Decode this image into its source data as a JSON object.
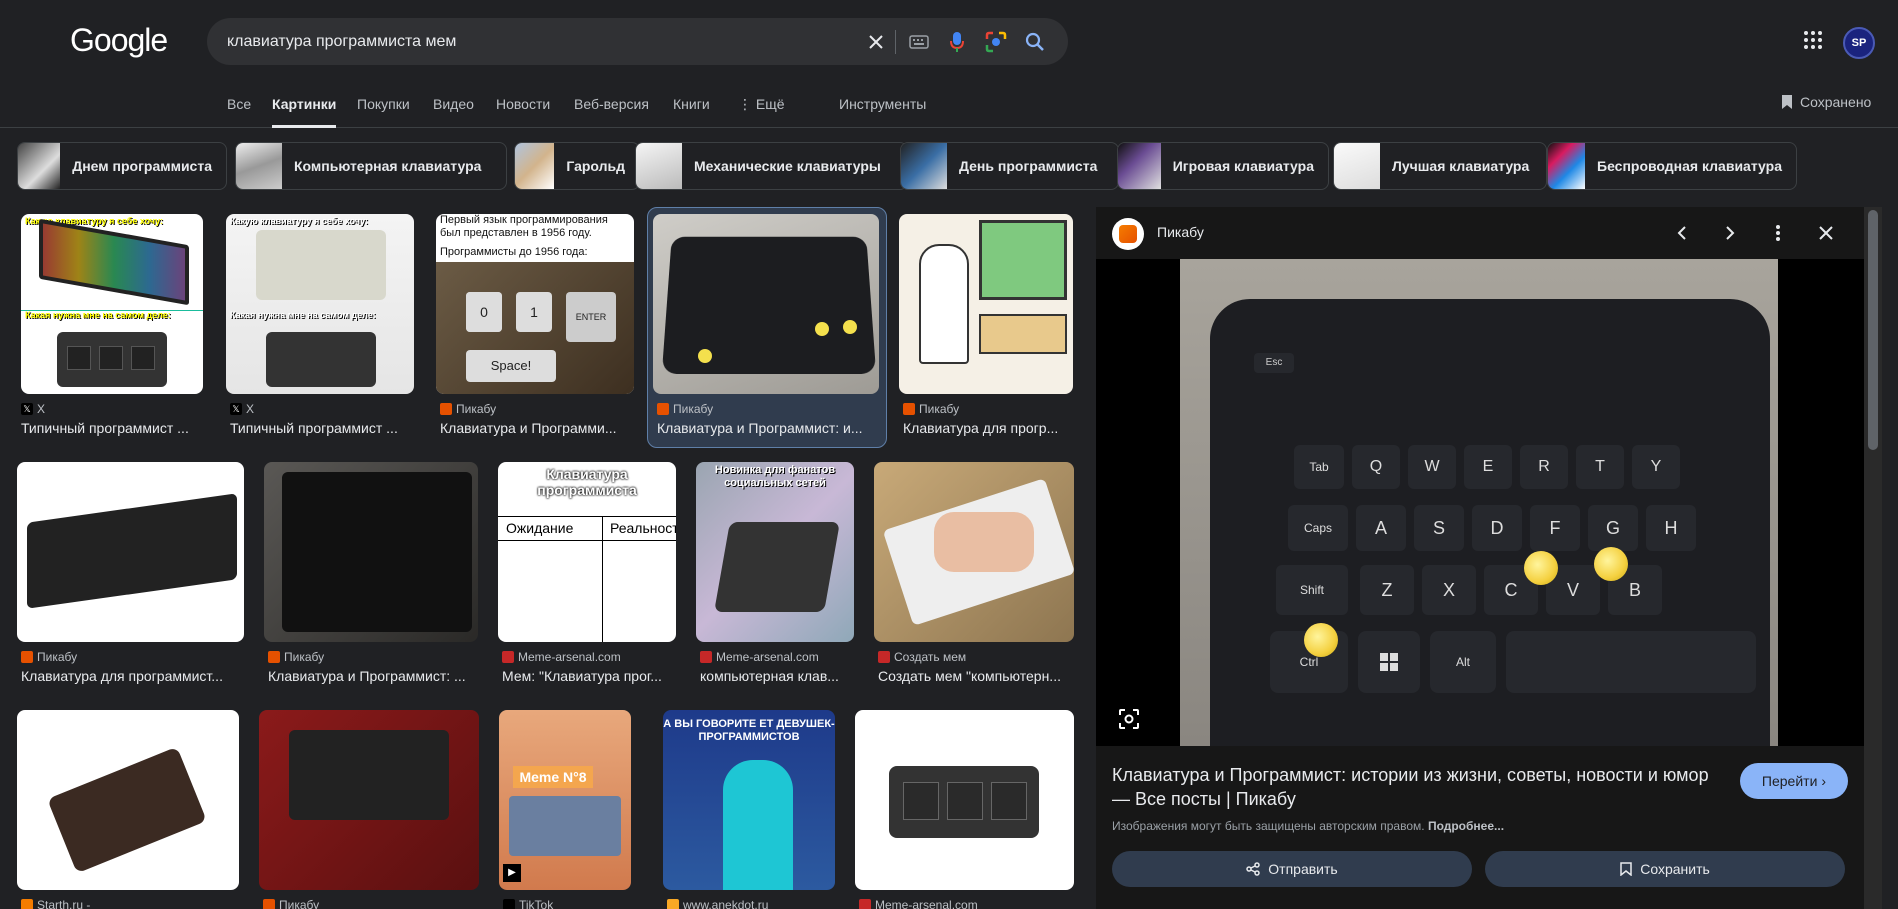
{
  "header": {
    "logo": "Google",
    "search_value": "клавиатура программиста мем",
    "avatar_initials": "SP"
  },
  "tabs": [
    {
      "label": "Все"
    },
    {
      "label": "Картинки",
      "active": true
    },
    {
      "label": "Покупки"
    },
    {
      "label": "Видео"
    },
    {
      "label": "Новости"
    },
    {
      "label": "Веб-версия"
    },
    {
      "label": "Книги"
    },
    {
      "label": "Ещё"
    },
    {
      "label": "Инструменты"
    }
  ],
  "saved_label": "Сохранено",
  "chips": [
    {
      "label": "Днем программиста"
    },
    {
      "label": "Компьютерная клавиатура"
    },
    {
      "label": "Гарольд"
    },
    {
      "label": "Механические клавиатуры"
    },
    {
      "label": "День программиста"
    },
    {
      "label": "Игровая клавиатура"
    },
    {
      "label": "Лучшая клавиатура"
    },
    {
      "label": "Беспроводная клавиатура"
    }
  ],
  "results": [
    {
      "source": "X",
      "title": "Типичный программист ...",
      "img_text_top": "Какую клавиатуру я себе хочу:",
      "img_text_bottom": "Какая нужна мне на самом деле:"
    },
    {
      "source": "X",
      "title": "Типичный программист ...",
      "img_text_top": "Какую клавиатуру я себе хочу:",
      "img_text_bottom": "Какая нужна мне на самом деле:"
    },
    {
      "source": "Пикабу",
      "title": "Клавиатура и Программи...",
      "img_text_top": "Первый язык программирования был представлен в 1956 году.",
      "img_text_mid": "Программисты до 1956 года:",
      "keys": [
        "0",
        "1",
        "ENTER",
        "Space!"
      ]
    },
    {
      "source": "Пикабу",
      "title": "Клавиатура и Программист: и..."
    },
    {
      "source": "Пикабу",
      "title": "Клавиатура для прогр..."
    },
    {
      "source": "Пикабу",
      "title": "Клавиатура для программист..."
    },
    {
      "source": "Пикабу",
      "title": "Клавиатура и Программист: ..."
    },
    {
      "source": "Meme-arsenal.com",
      "title": "Мем: \"Клавиатура прог...",
      "img_text_top": "Клавиатура программиста",
      "col1": "Ожидание",
      "col2": "Реальность"
    },
    {
      "source": "Meme-arsenal.com",
      "title": "компьютерная клав...",
      "img_text_top": "Новинка для фанатов социальных сетей"
    },
    {
      "source": "Создать мем",
      "title": "Создать мем \"компьютерн..."
    },
    {
      "source": "Starth.ru -"
    },
    {
      "source": "Пикабу"
    },
    {
      "source": "TikTok",
      "img_text_top": "Meme N°8"
    },
    {
      "source": "www.anekdot.ru",
      "img_text_top": "А ВЫ ГОВОРИТЕ ЕТ ДЕВУШЕК-ПРОГРАММИСТОВ"
    },
    {
      "source": "Meme-arsenal.com"
    }
  ],
  "panel": {
    "site": "Пикабу",
    "title": "Клавиатура и Программист: истории из жизни, советы, новости и юмор — Все посты | Пикабу",
    "visit_label": "Перейти",
    "copyright": "Изображения могут быть защищены авторским правом.",
    "more_link": "Подробнее...",
    "share_label": "Отправить",
    "save_label": "Сохранить",
    "keys": [
      "Esc",
      "Tab",
      "Q",
      "W",
      "E",
      "R",
      "T",
      "Y",
      "Caps",
      "A",
      "S",
      "D",
      "F",
      "G",
      "H",
      "Shift",
      "Z",
      "X",
      "C",
      "V",
      "B",
      "Ctrl",
      "Alt"
    ]
  }
}
